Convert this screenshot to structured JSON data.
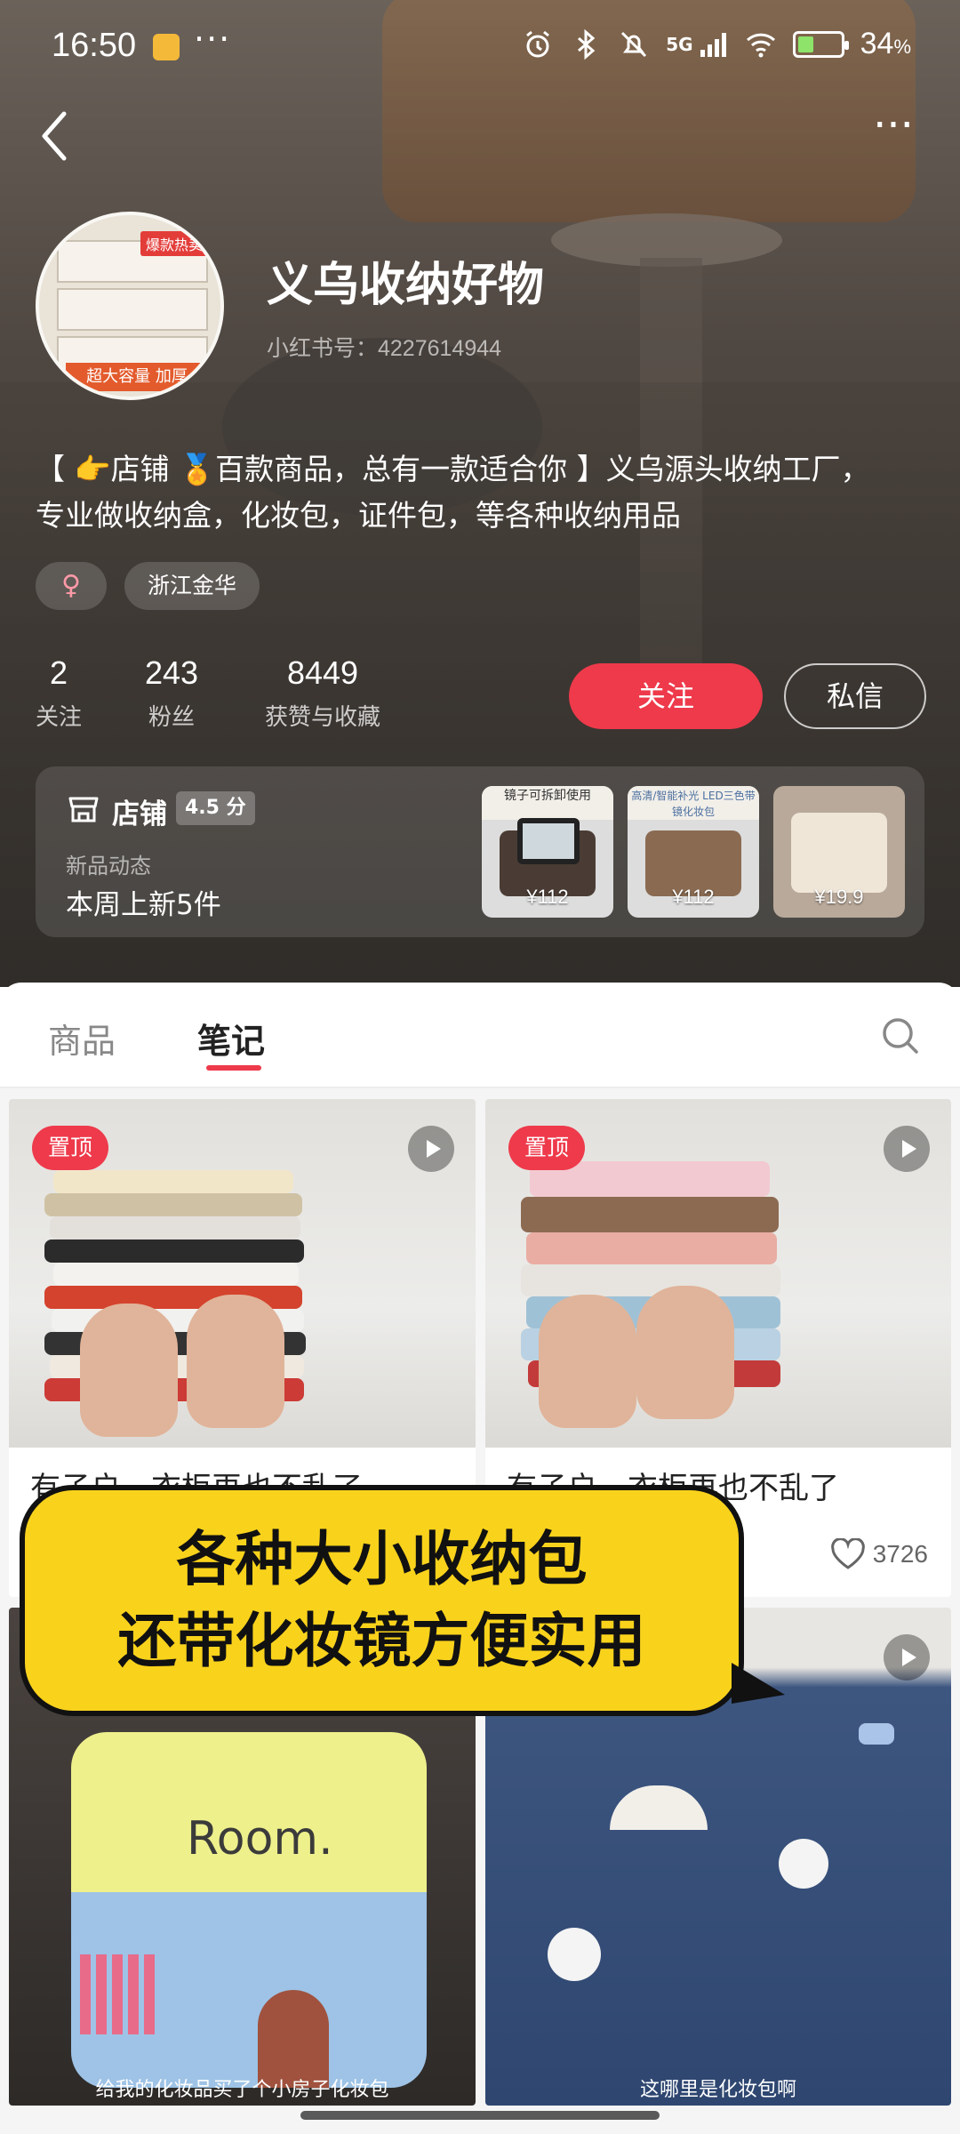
{
  "status_bar": {
    "time": "16:50",
    "overflow": "···",
    "network": "5G",
    "battery_percent": "34",
    "battery_unit": "%",
    "icons": [
      "alarm-icon",
      "bluetooth-icon",
      "mute-icon",
      "signal-icon",
      "wifi-icon",
      "battery-icon"
    ]
  },
  "nav": {
    "more": "···"
  },
  "profile": {
    "name": "义乌收纳好物",
    "id_text": "小红书号：4227614944",
    "bio_line1": "【 👉店铺 🏅百款商品，总有一款适合你 】义乌源头收纳工厂，",
    "bio_line2": "专业做收纳盒，化妆包，证件包，等各种收纳用品",
    "gender_symbol": "♀",
    "location": "浙江金华",
    "avatar_tag": "爆款热卖",
    "avatar_band": "超大容量 加厚"
  },
  "stats": [
    {
      "value": "2",
      "label": "关注"
    },
    {
      "value": "243",
      "label": "粉丝"
    },
    {
      "value": "8449",
      "label": "获赞与收藏"
    }
  ],
  "actions": {
    "follow": "关注",
    "message": "私信"
  },
  "store": {
    "name": "店铺",
    "score": "4.5 分",
    "new_label": "新品动态",
    "new_value": "本周上新5件",
    "products": [
      {
        "caption": "镜子可拆卸使用",
        "price": "¥112"
      },
      {
        "caption": "高清/智能补光 LED三色带镜化妆包",
        "price": "¥112"
      },
      {
        "caption": "",
        "price": "¥19.9"
      }
    ]
  },
  "tabs": {
    "goods": "商品",
    "notes": "笔记",
    "active": "notes"
  },
  "notes": [
    {
      "pinned": "置顶",
      "title": "有子户，衣柜再也不乱了",
      "likes": ""
    },
    {
      "pinned": "置顶",
      "title": "有子户，衣柜再也不乱了",
      "likes": "3726"
    },
    {
      "pinned": "",
      "title": "给我的化妆品买了个小房子化妆包",
      "bag_text": "Room.",
      "likes": ""
    },
    {
      "pinned": "",
      "title": "这哪里是化妆包啊",
      "likes": ""
    }
  ],
  "overlay": {
    "line1": "各种大小收纳包",
    "line2": "还带化妆镜方便实用"
  },
  "colors": {
    "accent": "#ee3a4b",
    "caption_bg": "#f9d21c"
  }
}
